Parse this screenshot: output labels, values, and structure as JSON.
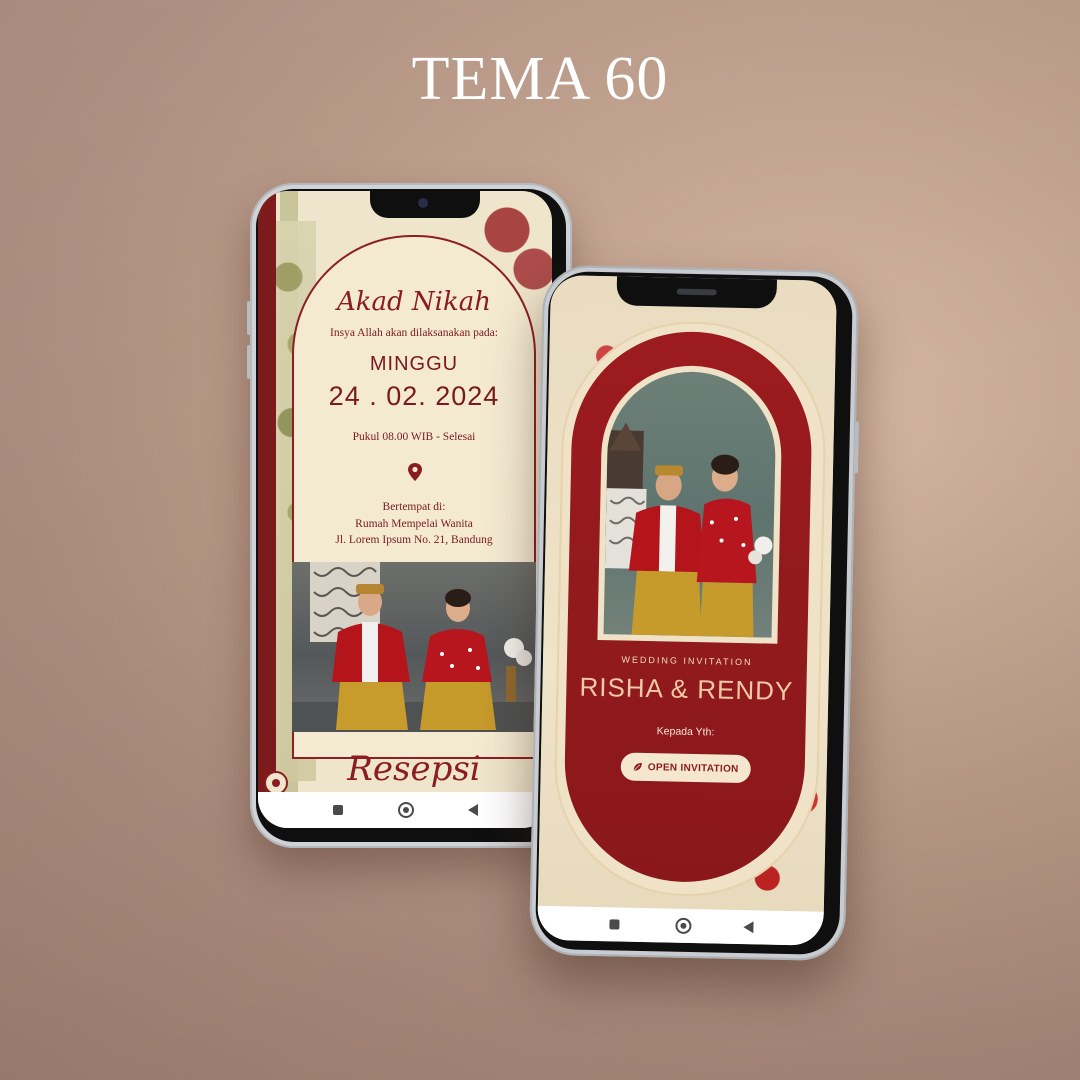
{
  "title": "TEMA 60",
  "akad_screen": {
    "heading": "Akad Nikah",
    "intro": "Insya Allah akan dilaksanakan pada:",
    "day": "MINGGU",
    "date": "24 . 02. 2024",
    "time": "Pukul 08.00 WIB - Selesai",
    "venue_label": "Bertempat di:",
    "venue_name": "Rumah Mempelai Wanita",
    "venue_address": "Jl. Lorem Ipsum No. 21, Bandung",
    "next_heading": "Resepsi"
  },
  "cover_screen": {
    "eyebrow": "WEDDING INVITATION",
    "couple_names": "RISHA & RENDY",
    "recipient_label": "Kepada Yth:",
    "open_button_label": "OPEN INVITATION"
  },
  "colors": {
    "maroon": "#8b1d20",
    "cream": "#efe5cc",
    "rose_gold": "#f2c9a6"
  },
  "icons": [
    "location-pin-icon",
    "music-disc-icon",
    "leaf-icon",
    "nav-recent-icon",
    "nav-home-icon",
    "nav-back-icon"
  ]
}
